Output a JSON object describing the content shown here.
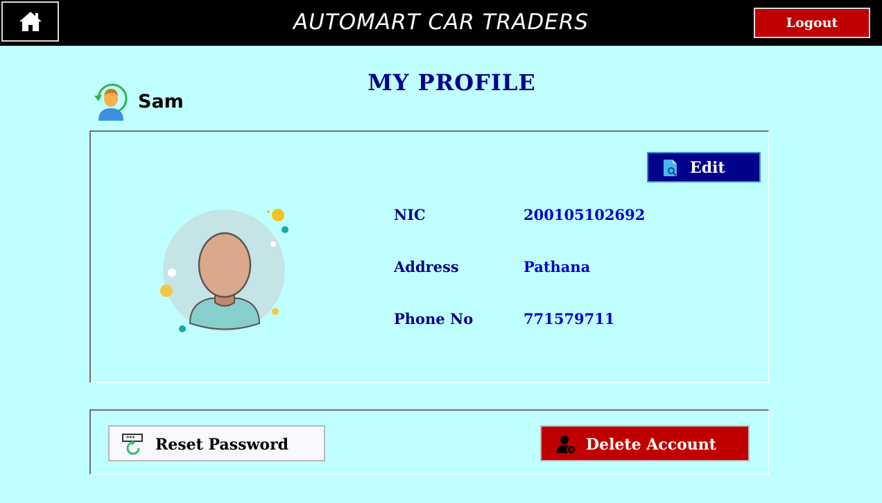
{
  "header": {
    "title": "AUTOMART CAR TRADERS",
    "home_icon": "home-icon",
    "logout_label": "Logout"
  },
  "page": {
    "title": "MY PROFILE"
  },
  "user": {
    "name": "Sam",
    "avatar_icon": "user-avatar-icon"
  },
  "profile": {
    "edit_label": "Edit",
    "edit_icon": "document-search-icon",
    "fields": [
      {
        "label": "NIC",
        "value": "200105102692"
      },
      {
        "label": "Address",
        "value": "Pathana"
      },
      {
        "label": "Phone No",
        "value": "771579711"
      }
    ]
  },
  "actions": {
    "reset_password_label": "Reset Password",
    "reset_password_icon": "password-reset-icon",
    "delete_account_label": "Delete Account",
    "delete_account_icon": "delete-user-icon"
  },
  "colors": {
    "background": "#c0ffff",
    "header_bg": "#000000",
    "title_blue": "#00008b",
    "value_blue": "#0000c8",
    "danger_red": "#c00000"
  }
}
